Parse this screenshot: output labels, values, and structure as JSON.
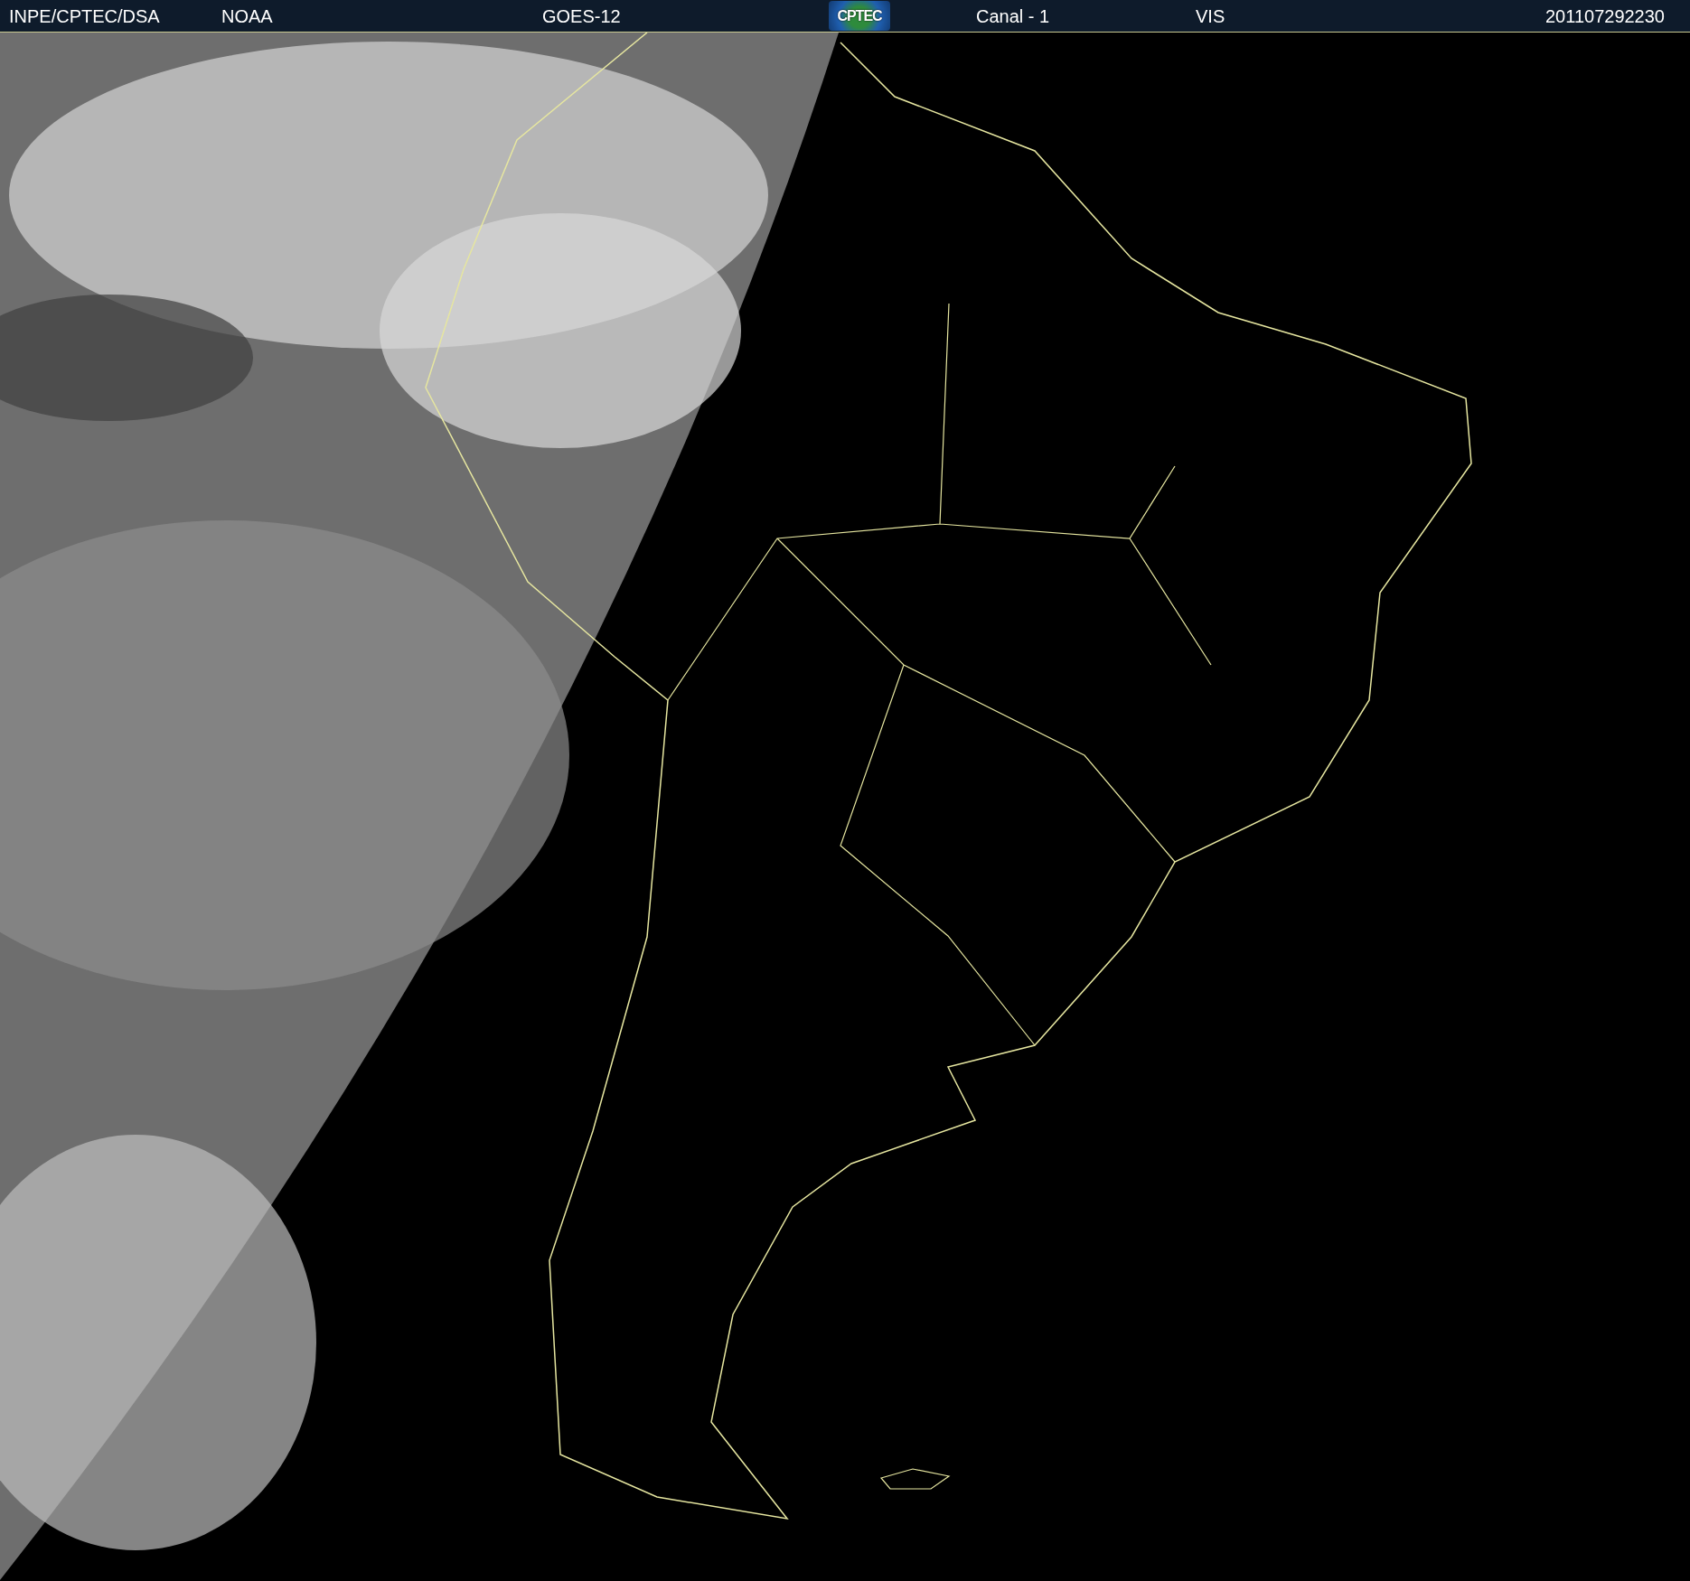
{
  "header": {
    "source": "INPE/CPTEC/DSA",
    "agency": "NOAA",
    "satellite": "GOES-12",
    "logo": "CPTEC",
    "channel": "Canal - 1",
    "band": "VIS",
    "timestamp": "201107292230"
  }
}
